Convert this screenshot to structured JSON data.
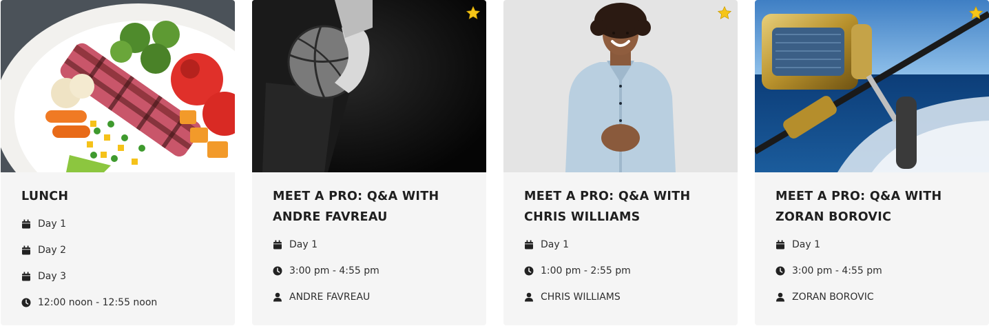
{
  "colors": {
    "card_bg": "#f5f5f5",
    "star": "#f5c518",
    "text": "#1f1f1f",
    "icon": "#222222"
  },
  "cards": [
    {
      "title_lines": [
        "LUNCH"
      ],
      "starred": false,
      "image": "food-plate-image",
      "meta": [
        {
          "icon": "calendar-icon",
          "text": "Day 1"
        },
        {
          "icon": "calendar-icon",
          "text": "Day 2"
        },
        {
          "icon": "calendar-icon",
          "text": "Day 3"
        },
        {
          "icon": "clock-icon",
          "text": "12:00 noon - 12:55 noon"
        }
      ]
    },
    {
      "title_lines": [
        "MEET A PRO: Q&A WITH",
        "ANDRE FAVREAU"
      ],
      "starred": true,
      "image": "basketball-player-image",
      "meta": [
        {
          "icon": "calendar-icon",
          "text": "Day 1"
        },
        {
          "icon": "clock-icon",
          "text": "3:00 pm - 4:55 pm"
        },
        {
          "icon": "user-icon",
          "text": "ANDRE FAVREAU"
        }
      ]
    },
    {
      "title_lines": [
        "MEET A PRO: Q&A WITH",
        "CHRIS WILLIAMS"
      ],
      "starred": true,
      "image": "smiling-man-image",
      "meta": [
        {
          "icon": "calendar-icon",
          "text": "Day 1"
        },
        {
          "icon": "clock-icon",
          "text": "1:00 pm - 2:55 pm"
        },
        {
          "icon": "user-icon",
          "text": "CHRIS WILLIAMS"
        }
      ]
    },
    {
      "title_lines": [
        "MEET A PRO: Q&A WITH",
        "ZORAN BOROVIC"
      ],
      "starred": true,
      "image": "fishing-reel-image",
      "meta": [
        {
          "icon": "calendar-icon",
          "text": "Day 1"
        },
        {
          "icon": "clock-icon",
          "text": "3:00 pm - 4:55 pm"
        },
        {
          "icon": "user-icon",
          "text": "ZORAN BOROVIC"
        }
      ]
    }
  ]
}
